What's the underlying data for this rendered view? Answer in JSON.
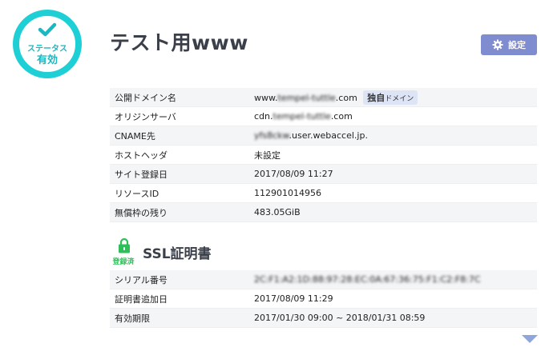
{
  "status": {
    "label_small": "ステータス",
    "label_main": "有効",
    "icon": "check-icon",
    "color": "#1fcfd6"
  },
  "page": {
    "title": "テスト用www"
  },
  "header": {
    "settings_label": "設定",
    "settings_icon": "gear-icon",
    "button_color": "#7f8ccf"
  },
  "info": {
    "rows": [
      {
        "key": "公開ドメイン名",
        "value": "www.",
        "blur": "tempel-tuttle",
        "suffix": ".com",
        "badge_main": "独自",
        "badge_sub": "ドメイン"
      },
      {
        "key": "オリジンサーバ",
        "value": "cdn.",
        "blur": "tempel-tuttle",
        "suffix": ".com"
      },
      {
        "key": "CNAME先",
        "value": "",
        "blur": "yfs8ckw",
        "suffix": ".user.webaccel.jp."
      },
      {
        "key": "ホストヘッダ",
        "value": "未設定"
      },
      {
        "key": "サイト登録日",
        "value": "2017/08/09 11:27"
      },
      {
        "key": "リソースID",
        "value": "112901014956"
      },
      {
        "key": "無償枠の残り",
        "value": "483.05GiB"
      }
    ]
  },
  "ssl": {
    "title": "SSL証明書",
    "registered_label": "登録済",
    "lock_icon": "lock-icon",
    "rows": [
      {
        "key": "シリアル番号",
        "blur": "2C:F1:A2:1D:88:97:28:EC:0A:67:36:75:F1:C2:F8:7C"
      },
      {
        "key": "証明書追加日",
        "value": "2017/08/09 11:29"
      },
      {
        "key": "有効期限",
        "value": "2017/01/30 09:00 ~ 2018/01/31 08:59"
      }
    ]
  },
  "scroll": {
    "icon": "scroll-down-arrow-icon"
  }
}
